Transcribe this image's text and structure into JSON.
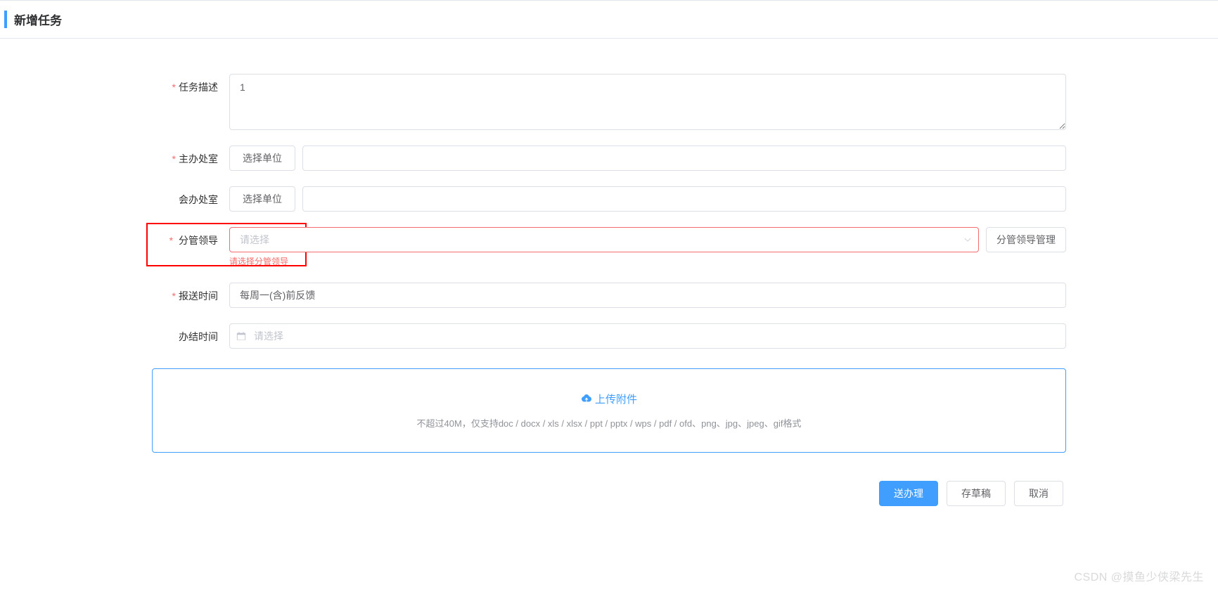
{
  "header": {
    "title": "新增任务"
  },
  "labels": {
    "task_desc": "任务描述",
    "host_unit": "主办处室",
    "co_unit": "会办处室",
    "leader": "分管领导",
    "report_time": "报送时间",
    "finish_time": "办结时间"
  },
  "values": {
    "task_desc": "1",
    "host_unit": "",
    "co_unit": "",
    "leader": "",
    "report_time": "每周一(含)前反馈",
    "finish_time": ""
  },
  "placeholders": {
    "leader": "请选择",
    "finish_time": "请选择"
  },
  "buttons": {
    "select_unit": "选择单位",
    "leader_manage": "分管领导管理",
    "submit": "送办理",
    "save_draft": "存草稿",
    "cancel": "取消"
  },
  "errors": {
    "leader": "请选择分管领导"
  },
  "upload": {
    "title": "上传附件",
    "hint": "不超过40M，仅支持doc / docx / xls / xlsx / ppt / pptx / wps / pdf / ofd、png、jpg、jpeg、gif格式"
  },
  "watermark": "CSDN @摸鱼少侠梁先生"
}
